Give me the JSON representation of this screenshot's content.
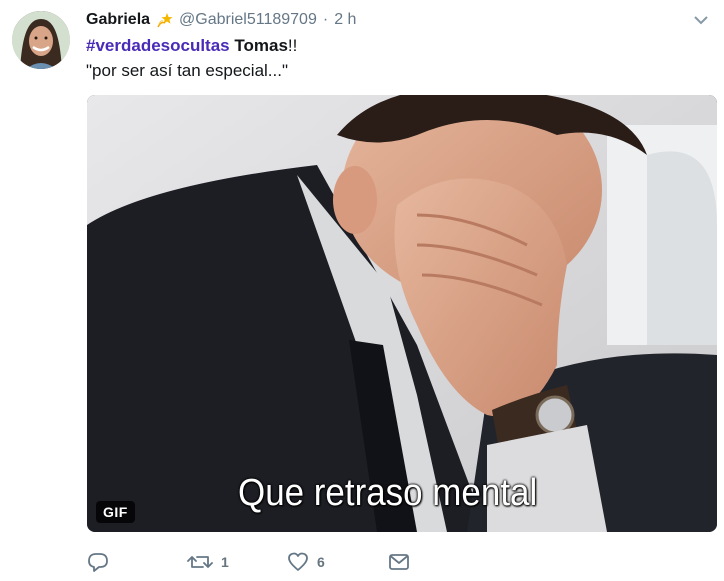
{
  "tweet": {
    "display_name": "Gabriela",
    "name_emoji_icon": "dizzy-star-icon",
    "handle": "@Gabriel51189709",
    "separator": "·",
    "time": "2 h",
    "text": {
      "hashtag": "#verdadesocultas",
      "space": " ",
      "mention_name": "Tomas",
      "exclamation": "!!",
      "quote": "\"por ser así tan especial...\""
    },
    "media": {
      "badge": "GIF",
      "caption": "Que retraso mental"
    },
    "actions": {
      "reply_icon": "reply-icon",
      "retweet_icon": "retweet-icon",
      "retweet_count": "1",
      "like_icon": "heart-icon",
      "like_count": "6",
      "dm_icon": "envelope-icon"
    }
  },
  "colors": {
    "hashtag": "#4a2bb8",
    "secondary_text": "#657786",
    "primary_text": "#14171a"
  }
}
